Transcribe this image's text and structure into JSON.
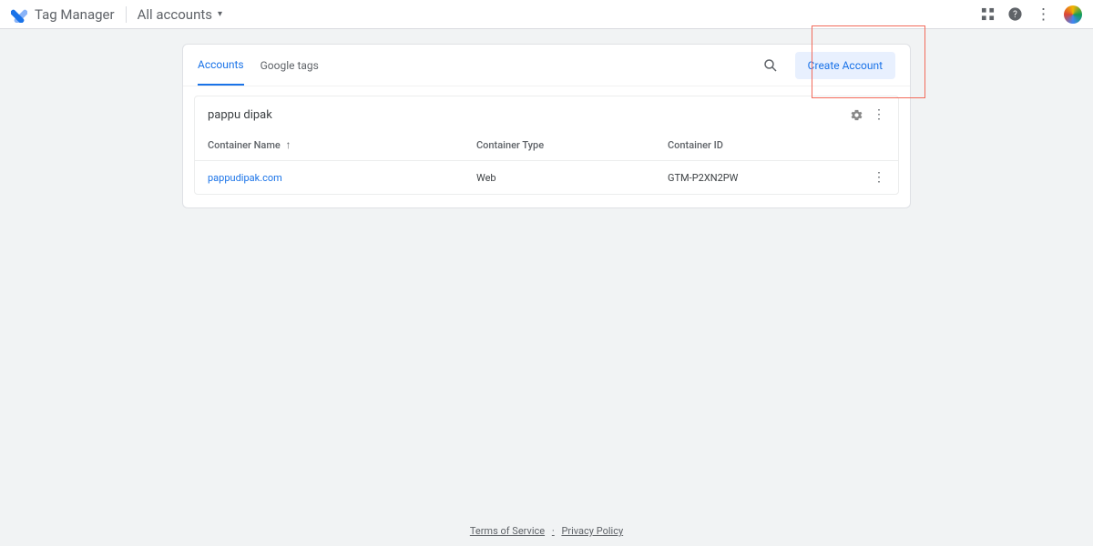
{
  "header": {
    "product_name": "Tag Manager",
    "account_selector_label": "All accounts"
  },
  "tabs": {
    "accounts": "Accounts",
    "google_tags": "Google tags"
  },
  "actions": {
    "create_account": "Create Account"
  },
  "account": {
    "name": "pappu dipak",
    "columns": {
      "name": "Container Name",
      "type": "Container Type",
      "id": "Container ID"
    },
    "rows": [
      {
        "name": "pappudipak.com",
        "type": "Web",
        "id": "GTM-P2XN2PW"
      }
    ]
  },
  "footer": {
    "tos": "Terms of Service",
    "privacy": "Privacy Policy",
    "sep": "·"
  }
}
